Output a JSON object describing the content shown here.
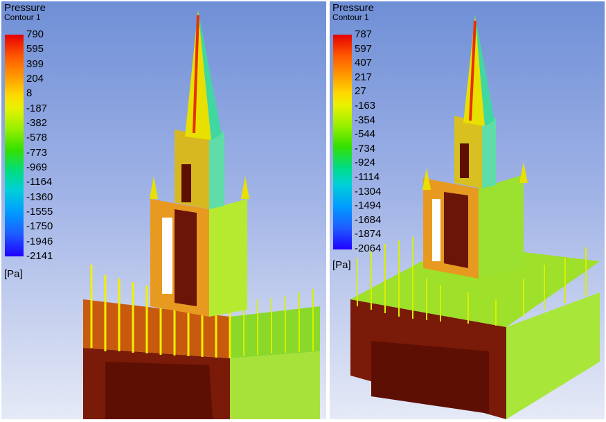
{
  "panels": [
    {
      "legend_title": "Pressure",
      "legend_subtitle": "Contour 1",
      "ticks": [
        "790",
        "595",
        "399",
        "204",
        "8",
        "-187",
        "-382",
        "-578",
        "-773",
        "-969",
        "-1164",
        "-1360",
        "-1555",
        "-1750",
        "-1946",
        "-2141"
      ],
      "unit": "[Pa]"
    },
    {
      "legend_title": "Pressure",
      "legend_subtitle": "Contour 1",
      "ticks": [
        "787",
        "597",
        "407",
        "217",
        "27",
        "-163",
        "-354",
        "-544",
        "-734",
        "-924",
        "-1114",
        "-1304",
        "-1494",
        "-1684",
        "-1874",
        "-2064"
      ],
      "unit": "[Pa]"
    }
  ],
  "colors": {
    "max": "#e60000",
    "mid": "#e8f200",
    "min": "#2000ff",
    "dark_face": "#6b1408",
    "green_face": "#9cf000"
  }
}
